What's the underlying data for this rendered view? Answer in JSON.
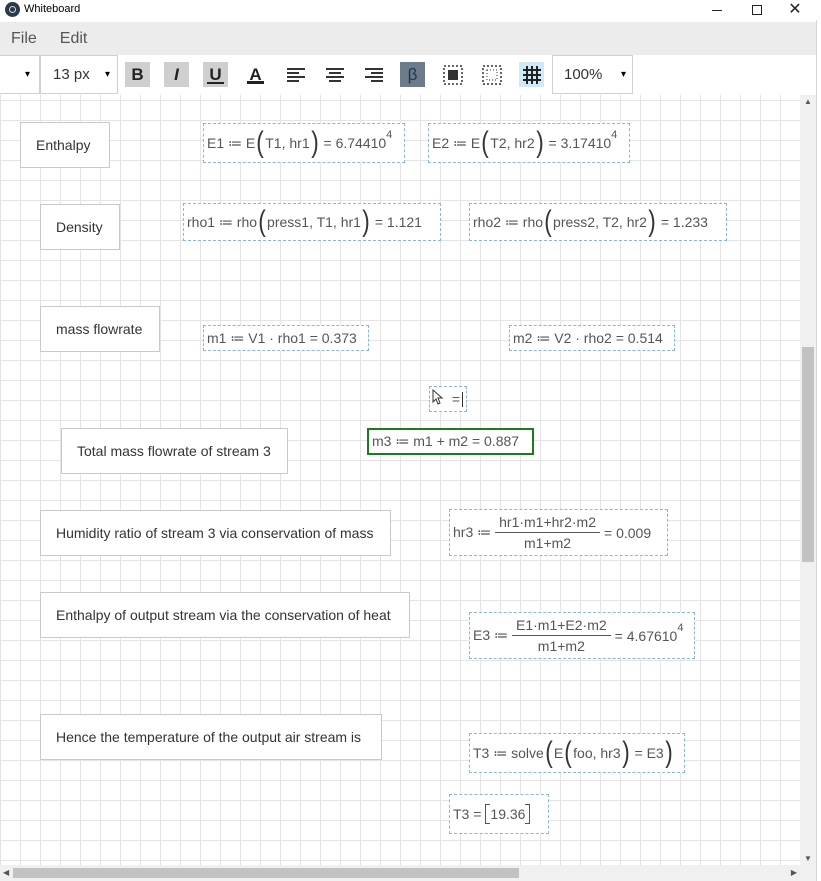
{
  "window": {
    "title": "Whiteboard"
  },
  "menu": {
    "file": "File",
    "edit": "Edit"
  },
  "toolbar": {
    "font_size": "13 px",
    "zoom": "100%",
    "bold": "B",
    "italic": "I",
    "underline": "U",
    "font_color": "A",
    "symbol": "β",
    "caret": "▾"
  },
  "labels": {
    "enthalpy": "Enthalpy",
    "density": "Density",
    "mass_flowrate": "mass flowrate",
    "total_mass": "Total mass flowrate of stream 3",
    "humidity": "Humidity ratio of stream 3 via conservation of mass",
    "enthalpy_out": "Enthalpy of output stream via the conservation of heat",
    "temperature": "Hence the temperature of the output air stream is"
  },
  "math": {
    "e1": {
      "lhs": "E1 ≔ E",
      "args": "T1, hr1",
      "result": "= 6.74410",
      "exp": "4"
    },
    "e2": {
      "lhs": "E2 ≔ E",
      "args": "T2, hr2",
      "result": "= 3.17410",
      "exp": "4"
    },
    "rho1": {
      "lhs": "rho1 ≔ rho",
      "args": "press1, T1, hr1",
      "result": "= 1.121"
    },
    "rho2": {
      "lhs": "rho2 ≔ rho",
      "args": "press2, T2, hr2",
      "result": "= 1.233"
    },
    "m1": "m1 ≔ V1 · rho1 = 0.373",
    "m2": "m2 ≔ V2 · rho2 = 0.514",
    "cursor_expr": "=",
    "m3": "m3 ≔ m1 + m2 = 0.887",
    "hr3": {
      "lhs": "hr3 ≔",
      "num": "hr1·m1+hr2·m2",
      "den": "m1+m2",
      "result": "= 0.009"
    },
    "e3": {
      "lhs": "E3 ≔",
      "num": "E1·m1+E2·m2",
      "den": "m1+m2",
      "result": "= 4.67610",
      "exp": "4"
    },
    "t3_solve": {
      "lhs": "T3 ≔ solve",
      "inner_fn": "E",
      "args": "foo, hr3",
      "rhs": "= E3"
    },
    "t3_eval": {
      "lhs": "T3 =",
      "value": "19.36"
    }
  },
  "colors": {
    "selected_border": "#1e7a1e",
    "active_tool": "#cfe9f7",
    "menu_bg": "#ececec"
  },
  "scrollbar": {
    "vertical_fraction": 0.28,
    "horizontal_fraction": 0.63
  }
}
